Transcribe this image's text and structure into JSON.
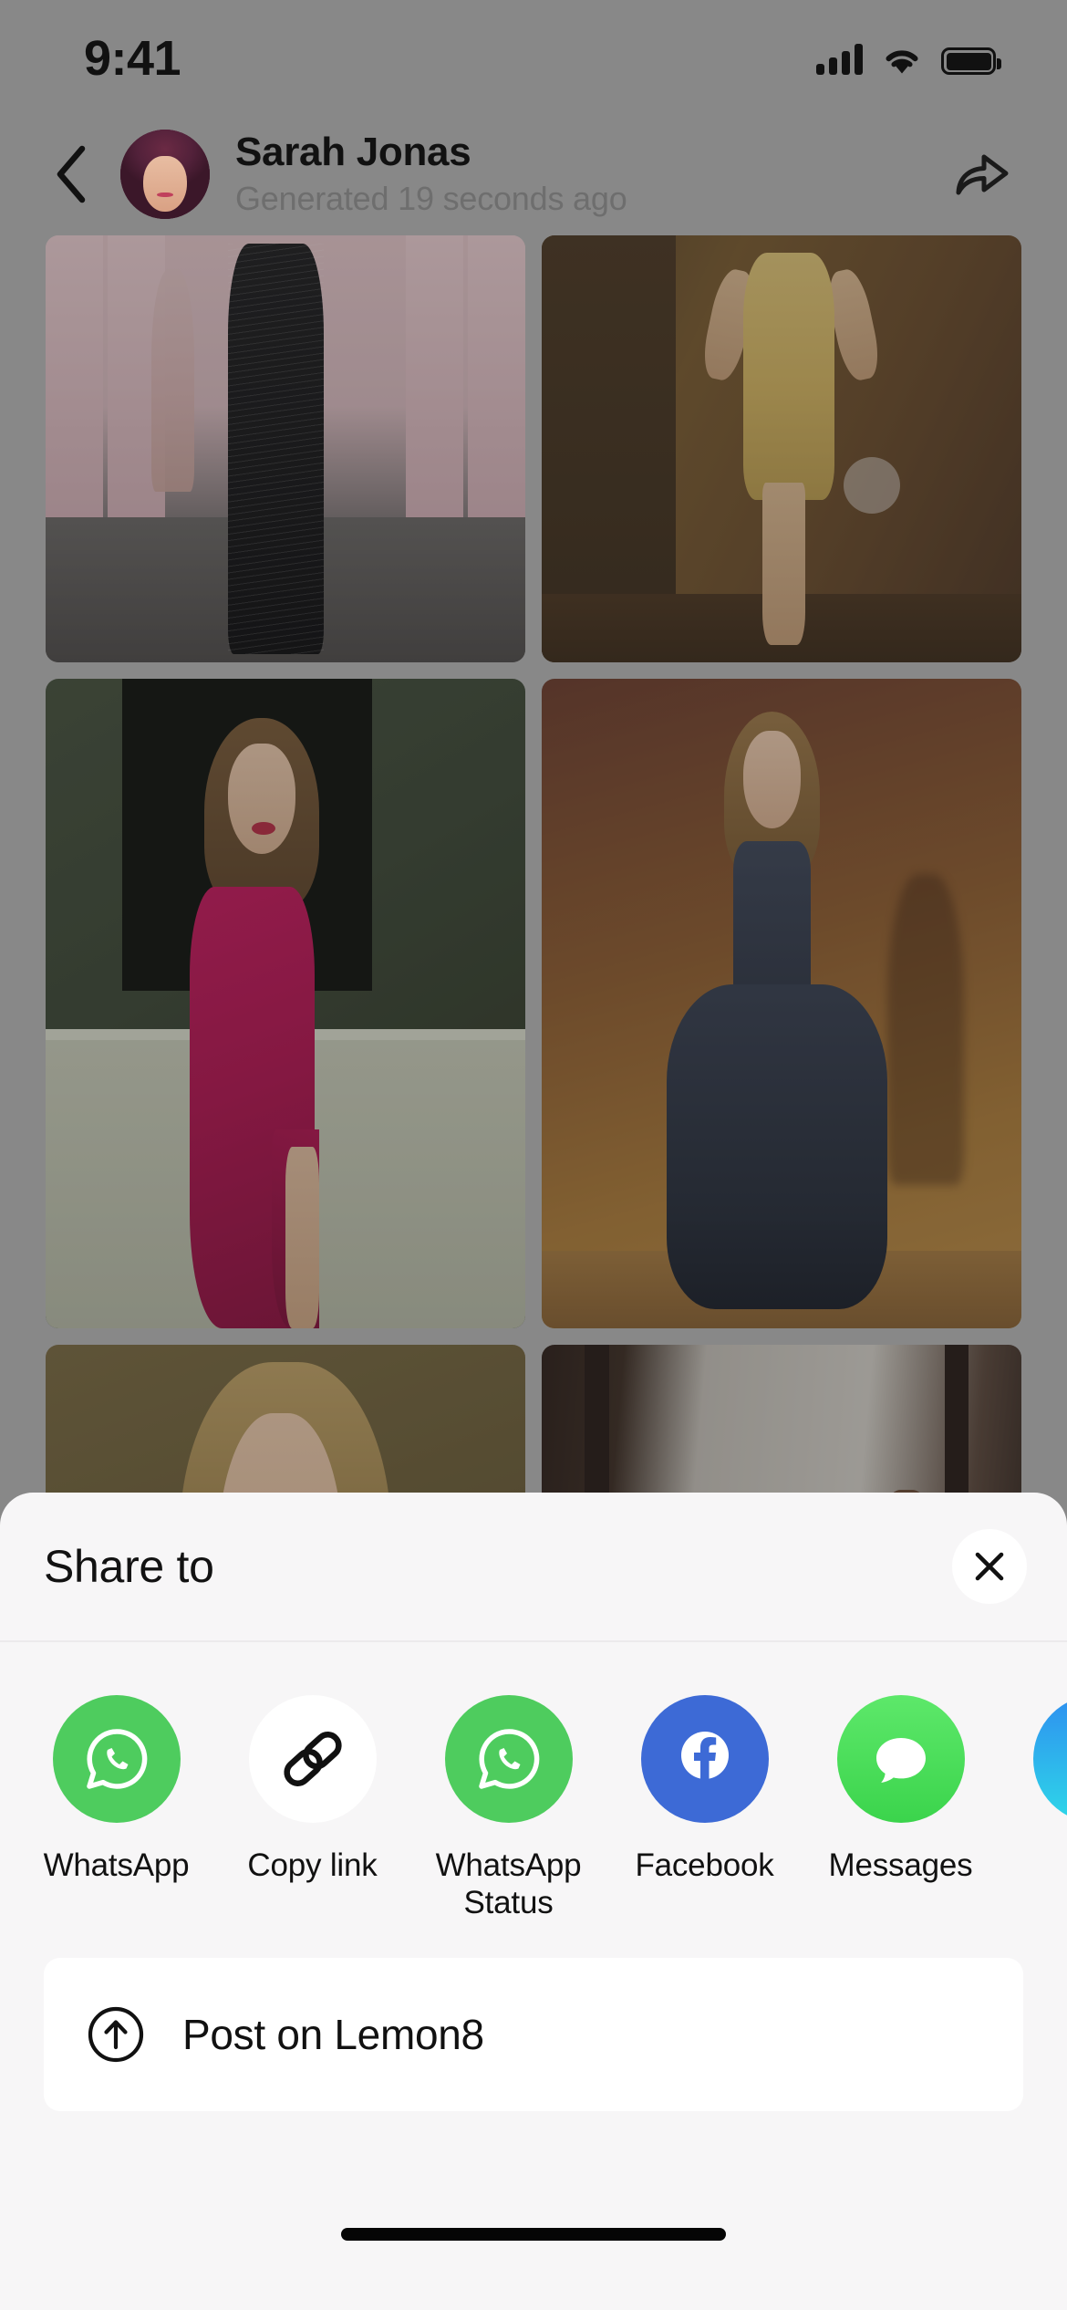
{
  "status_bar": {
    "time": "9:41",
    "cellular_icon": "cellular-signal-icon",
    "wifi_icon": "wifi-icon",
    "battery_icon": "battery-full-icon"
  },
  "header": {
    "back_icon": "chevron-left-icon",
    "avatar_icon": "user-avatar",
    "title": "Sarah Jonas",
    "subtitle": "Generated 19 seconds ago",
    "share_icon": "share-forward-icon"
  },
  "gallery": {
    "tiles": [
      {
        "name": "runway-black-beaded-gown",
        "alt": "Model in black beaded gown on pink runway"
      },
      {
        "name": "gold-sequin-gown",
        "alt": "Model in gold sequin gown against brown wall"
      },
      {
        "name": "magenta-satin-gown",
        "alt": "Model in magenta satin gown in green interior"
      },
      {
        "name": "navy-ballgown",
        "alt": "Model in navy high-low ballgown on warm backdrop"
      },
      {
        "name": "khaki-portrait",
        "alt": "Close portrait on khaki background"
      },
      {
        "name": "hallway-mirror",
        "alt": "Model in bright hallway doorway"
      }
    ],
    "overlay_dot": "loading-dot-indicator"
  },
  "share_sheet": {
    "title": "Share to",
    "close_icon": "close-x-icon",
    "targets": [
      {
        "label": "WhatsApp",
        "icon": "whatsapp-icon",
        "color": "#4ECC5E",
        "fg": "#FFFFFF"
      },
      {
        "label": "Copy link",
        "icon": "copy-link-icon",
        "color": "#FFFFFF",
        "fg": "#111111"
      },
      {
        "label": "WhatsApp Status",
        "icon": "whatsapp-status-icon",
        "color": "#4ECC5E",
        "fg": "#FFFFFF"
      },
      {
        "label": "Facebook",
        "icon": "facebook-icon",
        "color": "#3D6AD6",
        "fg": "#FFFFFF"
      },
      {
        "label": "Messages",
        "icon": "messages-icon",
        "color": "#4CE05B",
        "fg": "#FFFFFF"
      },
      {
        "label": "",
        "icon": "telegram-icon",
        "color": "#2AA3F0",
        "fg": "#FFFFFF"
      }
    ],
    "post_row": {
      "label": "Post on Lemon8",
      "icon": "arrow-up-circle-icon"
    }
  },
  "system": {
    "home_indicator": "home-indicator"
  },
  "colors": {
    "sheet_background": "#F7F6F7",
    "card_background": "#FFFFFF",
    "backdrop_dim": "#9C9C9C",
    "text_primary": "#111111",
    "text_secondary": "#6E6E6E",
    "whatsapp_green": "#4ECC5E",
    "facebook_blue": "#3D6AD6",
    "messages_green": "#4CE05B",
    "telegram_blue": "#2AA3F0"
  }
}
